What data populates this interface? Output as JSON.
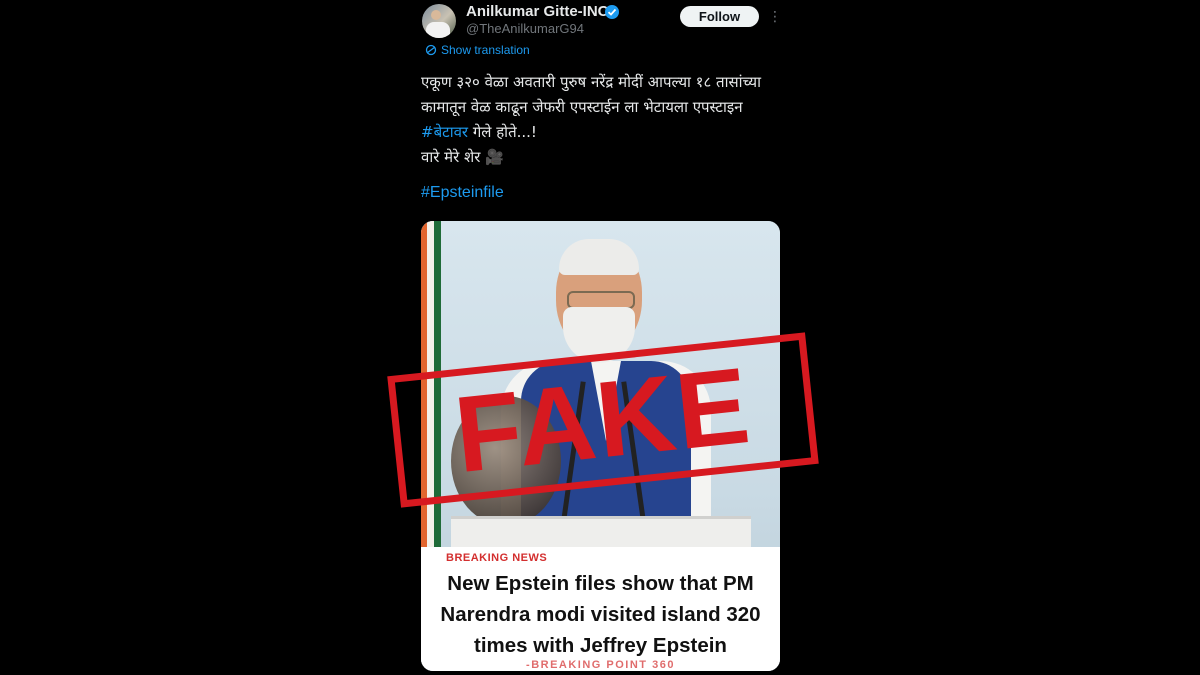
{
  "header": {
    "display_name": "Anilkumar Gitte-INC",
    "handle": "@TheAnilkumarG94",
    "follow_label": "Follow",
    "more_label": "⋮"
  },
  "translation": {
    "label": "Show translation"
  },
  "tweet": {
    "line1": "एकूण ३२० वेळा अवतारी पुरुष नरेंद्र मोदीं आपल्या १८ तासांच्या",
    "line2": "कामातून वेळ काढून जेफरी एपस्टाईन ला भेटायला एपस्टाइन",
    "line3_hashtag": "#बेटावर",
    "line3_rest": " गेले होते...!",
    "line4": " वारे मेरे शेर 🎥",
    "hashtag": "#Epsteinfile"
  },
  "media": {
    "breaking_label": "BREAKING NEWS",
    "headline_line1": "New Epstein files show that PM",
    "headline_line2": "Narendra modi visited island 320",
    "headline_line3": "times with Jeffrey Epstein",
    "source": "-BREAKING POINT 360"
  },
  "stamp": {
    "text": "FAKE"
  },
  "colors": {
    "background": "#000000",
    "link_blue": "#1d9bf0",
    "stamp_red": "#d71920",
    "breaking_red": "#d32f2f"
  }
}
